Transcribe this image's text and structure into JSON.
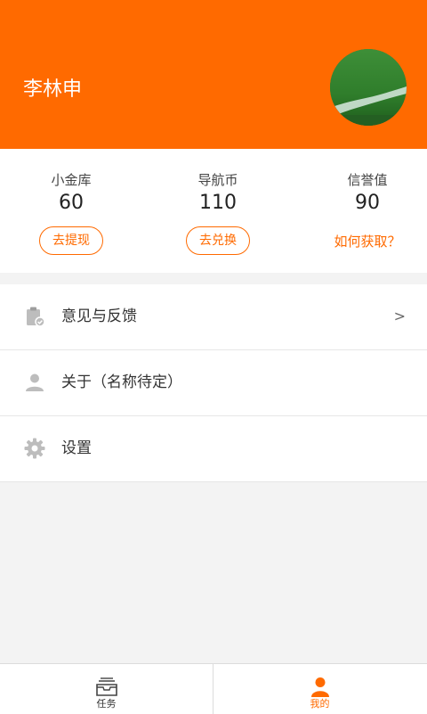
{
  "profile": {
    "name": "李林申"
  },
  "stats": [
    {
      "label": "小金库",
      "value": "60",
      "action": "去提现"
    },
    {
      "label": "导航币",
      "value": "110",
      "action": "去兑换"
    },
    {
      "label": "信誉值",
      "value": "90",
      "action": "如何获取？"
    }
  ],
  "menu": [
    {
      "label": "意见与反馈",
      "arrow": ">",
      "icon": "clipboard-icon"
    },
    {
      "label": "关于（名称待定）",
      "icon": "person-icon"
    },
    {
      "label": "设置",
      "icon": "gear-icon"
    }
  ],
  "tabs": [
    {
      "label": "任务",
      "icon": "inbox-tray-icon",
      "active": false
    },
    {
      "label": "我的",
      "icon": "person-icon",
      "active": true
    }
  ],
  "colors": {
    "accent": "#ff6a00",
    "icon_gray": "#bdbdbd"
  }
}
